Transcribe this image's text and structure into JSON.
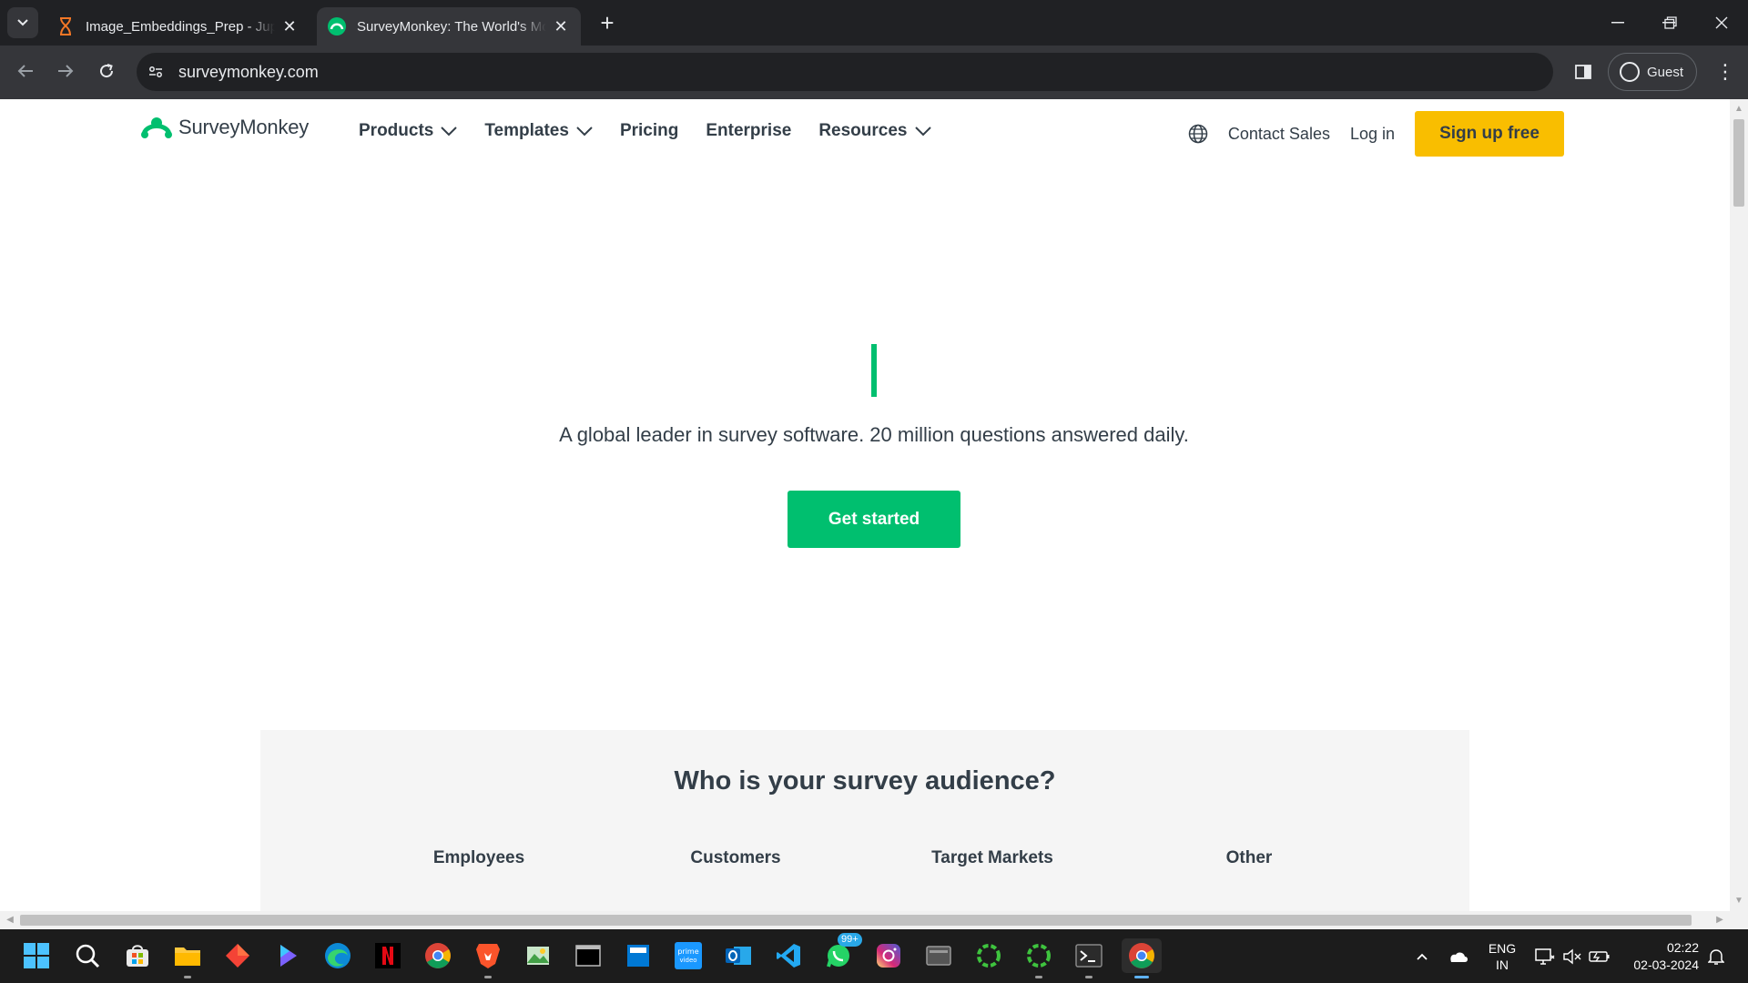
{
  "browser": {
    "tabs": [
      {
        "title": "Image_Embeddings_Prep - Jupyter",
        "active": false,
        "icon": "hourglass-icon"
      },
      {
        "title": "SurveyMonkey: The World's Most Popular Free Online Survey Tool",
        "active": true,
        "icon": "surveymonkey-favicon"
      }
    ],
    "new_tab_label": "+",
    "url": "surveymonkey.com",
    "profile_label": "Guest"
  },
  "site": {
    "logo_text": "SurveyMonkey",
    "nav": [
      {
        "label": "Products",
        "dropdown": true
      },
      {
        "label": "Templates",
        "dropdown": true
      },
      {
        "label": "Pricing",
        "dropdown": false
      },
      {
        "label": "Enterprise",
        "dropdown": false
      },
      {
        "label": "Resources",
        "dropdown": true
      }
    ],
    "contact_sales": "Contact Sales",
    "login": "Log in",
    "signup": "Sign up free",
    "hero_subtitle": "A global leader in survey software. 20 million questions answered daily.",
    "cta": "Get started",
    "audience_title": "Who is your survey audience?",
    "audience_tabs": [
      "Employees",
      "Customers",
      "Target Markets",
      "Other"
    ],
    "colors": {
      "brand_green": "#00bf6f",
      "cta_yellow": "#f9be00",
      "text_dark": "#333e48"
    }
  },
  "taskbar": {
    "apps": [
      "windows-start-icon",
      "search-icon",
      "microsoft-store-icon",
      "file-explorer-icon",
      "app-red-icon",
      "copilot-icon",
      "edge-icon",
      "netflix-icon",
      "chrome-icon",
      "brave-icon",
      "photos-app-icon",
      "terminal-app-icon",
      "calculator-blue-icon",
      "prime-video-icon",
      "outlook-icon",
      "vscode-icon",
      "whatsapp-icon",
      "instagram-icon",
      "media-app-icon",
      "green-ring-app-icon",
      "green-ring-app-2-icon",
      "powershell-icon",
      "chrome-active-icon"
    ],
    "whatsapp_badge": "99+",
    "lang_line1": "ENG",
    "lang_line2": "IN",
    "time": "02:22",
    "date": "02-03-2024"
  }
}
